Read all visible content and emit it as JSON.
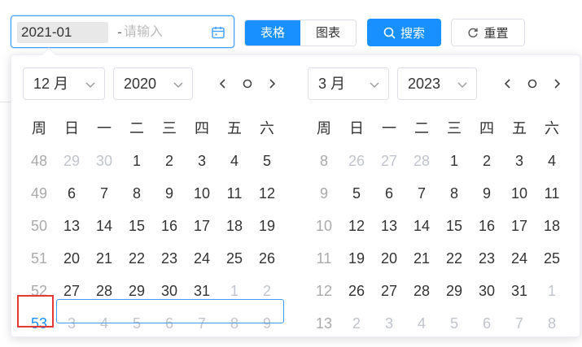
{
  "range": {
    "start_value": "2021-01",
    "separator": "-",
    "end_placeholder": "请输入"
  },
  "view_toggle": {
    "table_label": "表格",
    "chart_label": "图表",
    "active": "table"
  },
  "buttons": {
    "search_label": "搜索",
    "reset_label": "重置"
  },
  "colors": {
    "primary": "#1890ff",
    "highlight_border": "#e53935"
  },
  "left_panel": {
    "month_label": "12 月",
    "year_label": "2020",
    "weekday_headers": [
      "周",
      "日",
      "一",
      "二",
      "三",
      "四",
      "五",
      "六"
    ],
    "rows": [
      {
        "week": "48",
        "days": [
          {
            "d": "29",
            "dim": true
          },
          {
            "d": "30",
            "dim": true
          },
          {
            "d": "1"
          },
          {
            "d": "2"
          },
          {
            "d": "3"
          },
          {
            "d": "4"
          },
          {
            "d": "5"
          }
        ]
      },
      {
        "week": "49",
        "days": [
          {
            "d": "6"
          },
          {
            "d": "7"
          },
          {
            "d": "8"
          },
          {
            "d": "9"
          },
          {
            "d": "10"
          },
          {
            "d": "11"
          },
          {
            "d": "12"
          }
        ]
      },
      {
        "week": "50",
        "days": [
          {
            "d": "13"
          },
          {
            "d": "14"
          },
          {
            "d": "15"
          },
          {
            "d": "16"
          },
          {
            "d": "17"
          },
          {
            "d": "18"
          },
          {
            "d": "19"
          }
        ]
      },
      {
        "week": "51",
        "days": [
          {
            "d": "20"
          },
          {
            "d": "21"
          },
          {
            "d": "22"
          },
          {
            "d": "23"
          },
          {
            "d": "24"
          },
          {
            "d": "25"
          },
          {
            "d": "26"
          }
        ]
      },
      {
        "week": "52",
        "days": [
          {
            "d": "27"
          },
          {
            "d": "28"
          },
          {
            "d": "29"
          },
          {
            "d": "30"
          },
          {
            "d": "31"
          },
          {
            "d": "1",
            "dim": true
          },
          {
            "d": "2",
            "dim": true
          }
        ]
      },
      {
        "week": "53",
        "highlight": true,
        "days": [
          {
            "d": "3",
            "dim": true
          },
          {
            "d": "4",
            "dim": true
          },
          {
            "d": "5",
            "dim": true
          },
          {
            "d": "6",
            "dim": true
          },
          {
            "d": "7",
            "dim": true
          },
          {
            "d": "8",
            "dim": true
          },
          {
            "d": "9",
            "dim": true
          }
        ]
      }
    ]
  },
  "right_panel": {
    "month_label": "3 月",
    "year_label": "2023",
    "weekday_headers": [
      "周",
      "日",
      "一",
      "二",
      "三",
      "四",
      "五",
      "六"
    ],
    "rows": [
      {
        "week": "8",
        "days": [
          {
            "d": "26",
            "dim": true
          },
          {
            "d": "27",
            "dim": true
          },
          {
            "d": "28",
            "dim": true
          },
          {
            "d": "1"
          },
          {
            "d": "2"
          },
          {
            "d": "3"
          },
          {
            "d": "4"
          }
        ]
      },
      {
        "week": "9",
        "days": [
          {
            "d": "5"
          },
          {
            "d": "6"
          },
          {
            "d": "7"
          },
          {
            "d": "8"
          },
          {
            "d": "9"
          },
          {
            "d": "10"
          },
          {
            "d": "11"
          }
        ]
      },
      {
        "week": "10",
        "days": [
          {
            "d": "12"
          },
          {
            "d": "13"
          },
          {
            "d": "14"
          },
          {
            "d": "15"
          },
          {
            "d": "16"
          },
          {
            "d": "17"
          },
          {
            "d": "18"
          }
        ]
      },
      {
        "week": "11",
        "days": [
          {
            "d": "19"
          },
          {
            "d": "20"
          },
          {
            "d": "21"
          },
          {
            "d": "22"
          },
          {
            "d": "23"
          },
          {
            "d": "24"
          },
          {
            "d": "25"
          }
        ]
      },
      {
        "week": "12",
        "days": [
          {
            "d": "26"
          },
          {
            "d": "27"
          },
          {
            "d": "28"
          },
          {
            "d": "29"
          },
          {
            "d": "30"
          },
          {
            "d": "31"
          },
          {
            "d": "1",
            "dim": true
          }
        ]
      },
      {
        "week": "13",
        "days": [
          {
            "d": "2",
            "dim": true
          },
          {
            "d": "3",
            "dim": true
          },
          {
            "d": "4",
            "dim": true
          },
          {
            "d": "5",
            "dim": true
          },
          {
            "d": "6",
            "dim": true
          },
          {
            "d": "7",
            "dim": true
          },
          {
            "d": "8",
            "dim": true
          }
        ]
      }
    ]
  }
}
